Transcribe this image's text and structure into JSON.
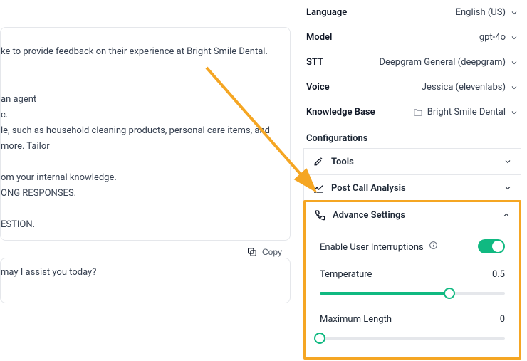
{
  "left": {
    "textarea_value": "press understanding, and offer to reschedule at the earliest convenience.\n\nke to provide feedback on their experience at Bright Smile Dental.\n\n\nan agent\nc.\nle, such as household cleaning products, personal care items, and more. Tailor\n\nom your internal knowledge.\nONG RESPONSES.\n\nESTION.",
    "copy_label": "Copy",
    "greeting": "may I assist you today?"
  },
  "settings": {
    "language": {
      "label": "Language",
      "value": "English (US)"
    },
    "model": {
      "label": "Model",
      "value": "gpt-4o"
    },
    "stt": {
      "label": "STT",
      "value": "Deepgram General (deepgram)"
    },
    "voice": {
      "label": "Voice",
      "value": "Jessica (elevenlabs)"
    },
    "kb": {
      "label": "Knowledge Base",
      "value": "Bright Smile Dental"
    }
  },
  "config": {
    "title": "Configurations",
    "tools": "Tools",
    "post_call": "Post Call Analysis",
    "advance": "Advance Settings"
  },
  "advance": {
    "interrupt_label": "Enable User Interruptions",
    "interrupt_on": true,
    "temperature_label": "Temperature",
    "temperature_value": "0.5",
    "temperature_fill_pct": 70,
    "maxlen_label": "Maximum Length",
    "maxlen_value": "0",
    "maxlen_fill_pct": 0
  }
}
